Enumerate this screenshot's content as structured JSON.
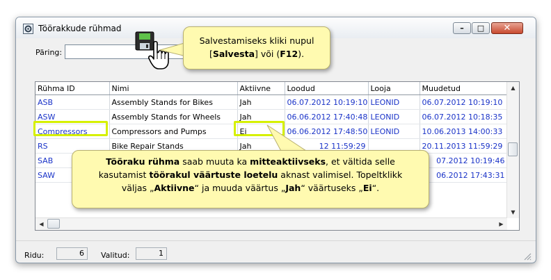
{
  "window": {
    "title": "Töörakkude rühmad",
    "min_glyph": "–",
    "max_glyph": "□",
    "close_glyph": "✕"
  },
  "query": {
    "label": "Päring:",
    "value": ""
  },
  "table": {
    "columns": [
      "Rühma ID",
      "Nimi",
      "Aktiivne",
      "Loodud",
      "Looja",
      "Muudetud"
    ],
    "rows": [
      [
        "ASB",
        "Assembly Stands for Bikes",
        "Jah",
        "06.07.2012 10:19:10",
        "LEONID",
        "06.07.2012 10:19:10"
      ],
      [
        "ASW",
        "Assembly Stands for Wheels",
        "Jah",
        "06.06.2012 17:40:48",
        "LEONID",
        "06.07.2012 10:18:35"
      ],
      [
        "Compressors",
        "Compressors and Pumps",
        "Ei",
        "06.06.2012 17:48:50",
        "LEONID",
        "10.06.2013 14:00:33"
      ],
      [
        "RS",
        "Bike Repair Stands",
        "Jah",
        "12 11:59:29",
        "",
        "20.11.2013 11:59:29"
      ],
      [
        "SAB",
        "",
        "",
        "",
        "",
        "07.2012 10:19:46"
      ],
      [
        "SAW",
        "",
        "",
        "",
        "",
        "06.2012 17:43:31"
      ]
    ]
  },
  "status": {
    "rows_label": "Ridu:",
    "rows_value": "6",
    "selected_label": "Valitud:",
    "selected_value": "1"
  },
  "callout_save": {
    "line1": "Salvestamiseks kliki nupul",
    "pre2": "[",
    "bold2": "Salvesta",
    "mid2": "] või (",
    "bold2b": "F12",
    "post2": ")."
  },
  "callout_active": {
    "b1": "Tööraku rühma",
    "t1": " saab muuta ka ",
    "b2": "mitteaktiivseks",
    "t2": ", et vältida selle",
    "t3": "kasutamist ",
    "b3": "töörakul väärtuste loetelu",
    "t4": " aknast valimisel. Topeltklikk",
    "t5": "väljas „",
    "b4": "Aktiivne",
    "t6": "“ ja muuda väärtus „",
    "b5": "Jah",
    "t7": "“ väärtuseks „",
    "b6": "Ei",
    "t8": "“."
  },
  "colors": {
    "id_link": "#1a33c8",
    "highlight": "#d6f000",
    "callout_bg": "#fffab0"
  }
}
